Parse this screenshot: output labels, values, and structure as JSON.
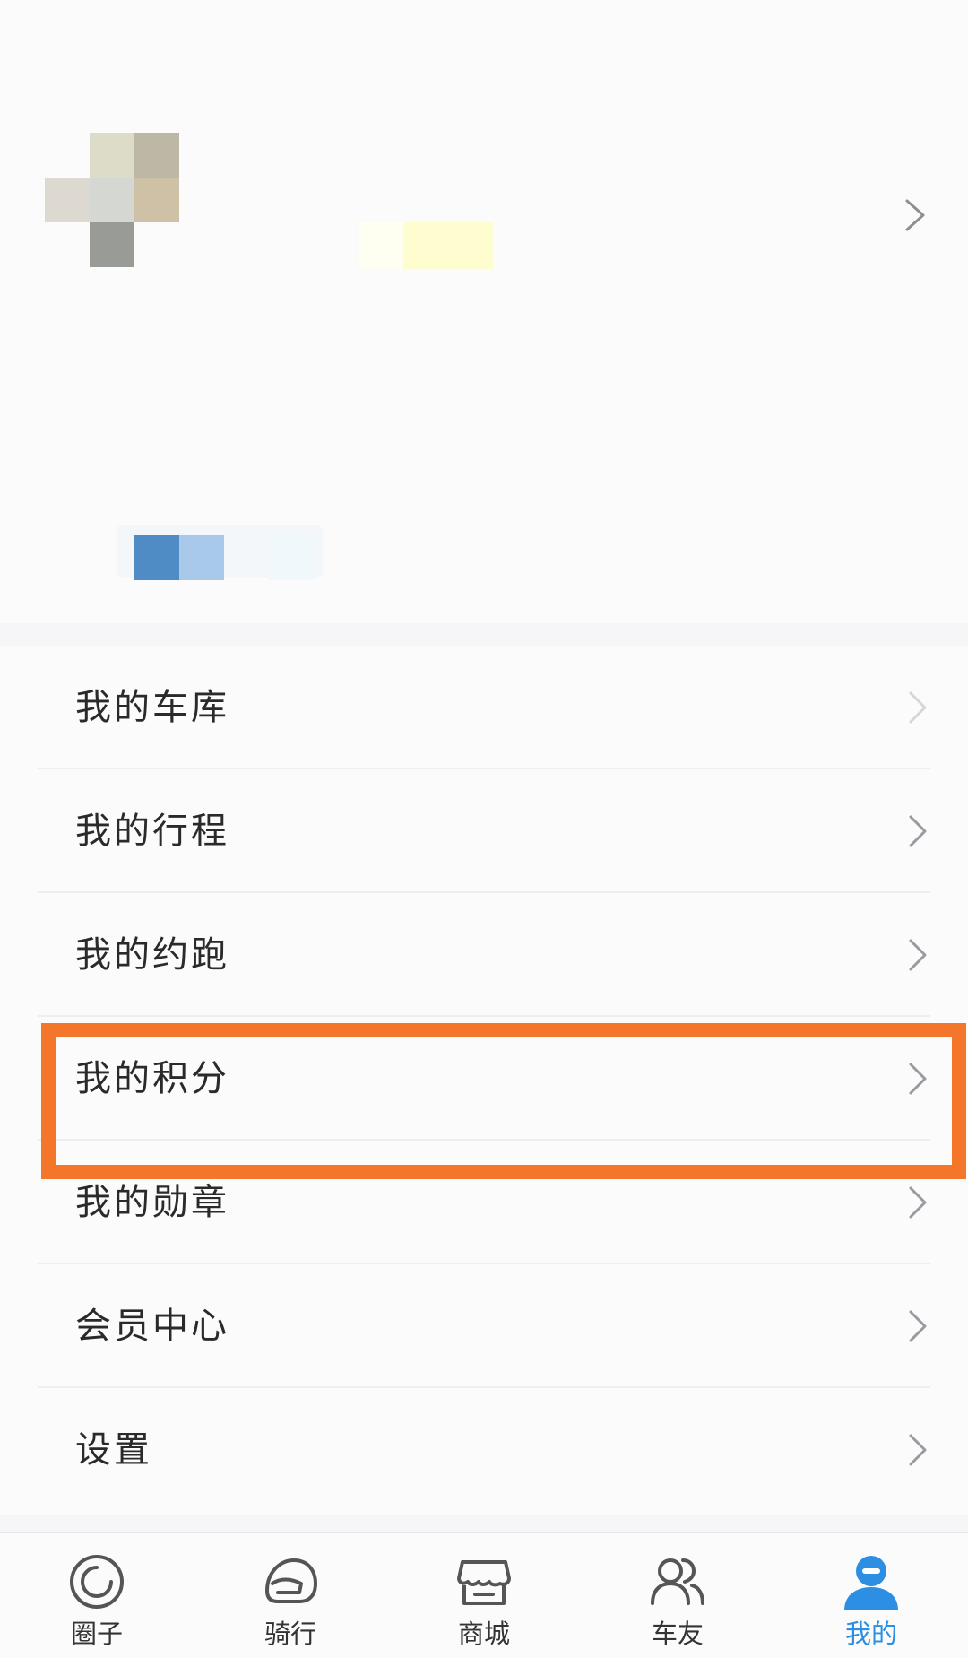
{
  "menu": {
    "items": [
      {
        "label": "我的车库"
      },
      {
        "label": "我的行程"
      },
      {
        "label": "我的约跑"
      },
      {
        "label": "我的积分"
      },
      {
        "label": "我的勋章"
      },
      {
        "label": "会员中心"
      },
      {
        "label": "设置"
      }
    ],
    "highlighted_item": "我的积分"
  },
  "tabbar": {
    "tabs": [
      {
        "label": "圈子",
        "icon": "circle-target-icon"
      },
      {
        "label": "骑行",
        "icon": "helmet-icon"
      },
      {
        "label": "商城",
        "icon": "shop-icon"
      },
      {
        "label": "车友",
        "icon": "friends-icon"
      },
      {
        "label": "我的",
        "icon": "user-profile-icon",
        "active": true
      }
    ]
  },
  "colors": {
    "accent_active": "#2c8fe3",
    "highlight_border": "#f4762a",
    "text_primary": "#2a2a2a"
  }
}
